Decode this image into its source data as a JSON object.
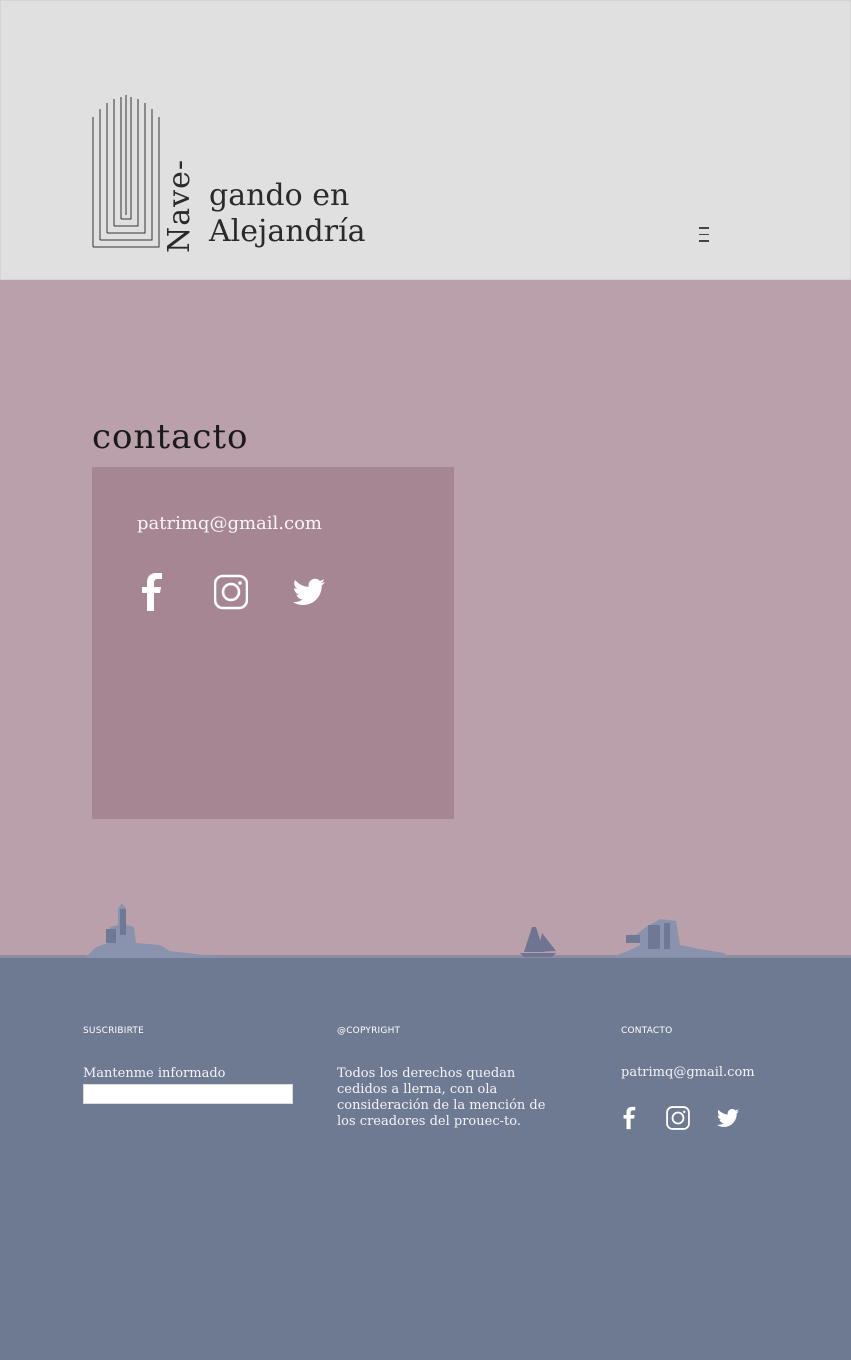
{
  "header": {
    "logo": {
      "vertical_word": "Nave-",
      "line1": "gando en",
      "line2": "Alejandría"
    },
    "menu_icon": "hamburger-menu-icon"
  },
  "main": {
    "title": "contacto",
    "card": {
      "email": "patrimq@gmail.com",
      "social_icons": [
        "facebook-icon",
        "instagram-icon",
        "twitter-icon"
      ]
    }
  },
  "footer": {
    "subscribe": {
      "heading": "SUSCRIBIRTE",
      "label": "Mantenme informado",
      "input_value": ""
    },
    "copyright": {
      "heading": "@COPYRIGHT",
      "text": "Todos los derechos quedan cedidos a llerna, con ola consideración de la mención de los creadores del prouec-to."
    },
    "contact": {
      "heading": "CONTACTO",
      "email": "patrimq@gmail.com",
      "social_icons": [
        "facebook-icon",
        "instagram-icon",
        "twitter-icon"
      ]
    }
  },
  "colors": {
    "header_bg": "#e0e0e0",
    "main_bg": "#b9a0aa",
    "card_bg": "#a68692",
    "footer_bg": "#6e7992"
  }
}
